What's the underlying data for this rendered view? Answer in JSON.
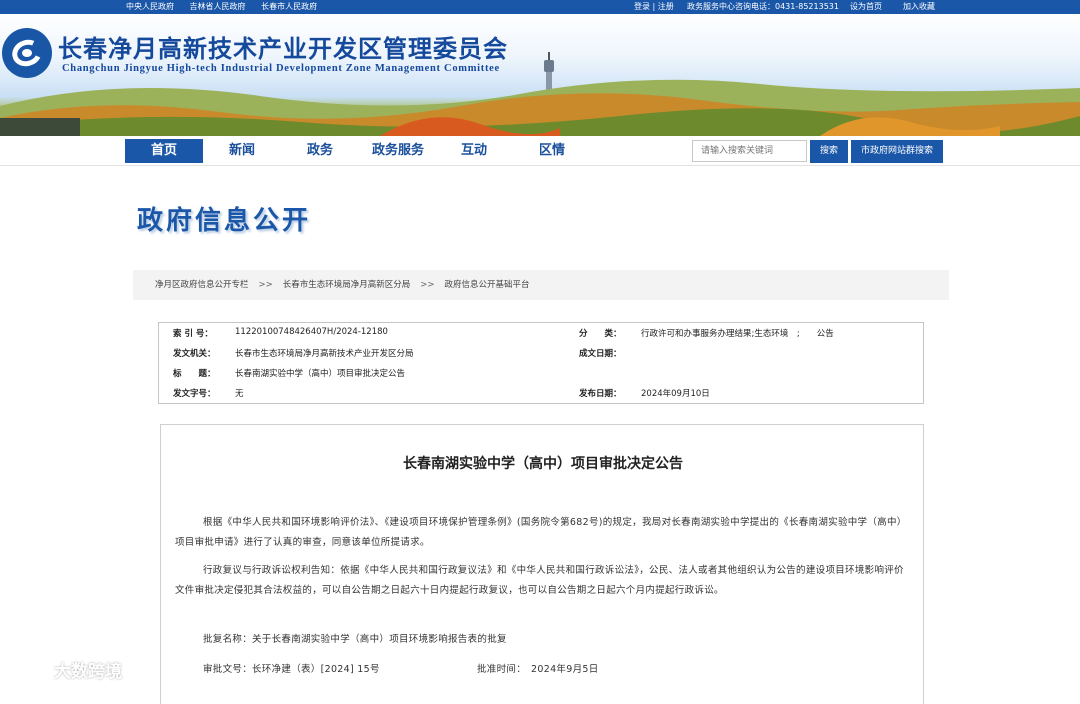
{
  "topbar": {
    "links": [
      "中央人民政府",
      "吉林省人民政府",
      "长春市人民政府"
    ],
    "login": "登录 | 注册",
    "hotline": "政务服务中心咨询电话：0431-85213531",
    "set_home": "设为首页",
    "favorite": "加入收藏"
  },
  "header": {
    "title": "长春净月高新技术产业开发区管理委员会",
    "subtitle": "Changchun Jingyue High-tech Industrial Development Zone Management Committee"
  },
  "nav": {
    "items": [
      "首页",
      "新闻",
      "政务",
      "政务服务",
      "互动",
      "区情"
    ],
    "active": "首页"
  },
  "search": {
    "placeholder": "请输入搜索关键词",
    "button": "搜索",
    "site_group_button": "市政府网站群搜索"
  },
  "section": {
    "title": "政府信息公开"
  },
  "breadcrumb": {
    "items": [
      "净月区政府信息公开专栏",
      "长春市生态环境局净月高新区分局",
      "政府信息公开基础平台"
    ],
    "separator": ">>"
  },
  "meta": {
    "index_label": "索 引 号：",
    "index_value": "11220100748426407H/2024-12180",
    "category_label": "分　　类：",
    "category_value": "行政许可和办事服务办理结果;生态环境　;　　公告",
    "issuer_label": "发文机关：",
    "issuer_value": "长春市生态环境局净月高新技术产业开发区分局",
    "written_date_label": "成文日期：",
    "written_date_value": "",
    "title_label": "标　　题：",
    "title_value": "长春南湖实验中学（高中）项目审批决定公告",
    "doc_no_label": "发文字号：",
    "doc_no_value": "无",
    "publish_date_label": "发布日期：",
    "publish_date_value": "2024年09月10日"
  },
  "article": {
    "title": "长春南湖实验中学（高中）项目审批决定公告",
    "paragraph1": "根据《中华人民共和国环境影响评价法》、《建设项目环境保护管理条例》(国务院令第682号)的规定，我局对长春南湖实验中学提出的《长春南湖实验中学（高中）项目审批申请》进行了认真的审查，同意该单位所提请求。",
    "paragraph2": "行政复议与行政诉讼权利告知：依据《中华人民共和国行政复议法》和《中华人民共和国行政诉讼法》，公民、法人或者其他组织认为公告的建设项目环境影响评价文件审批决定侵犯其合法权益的，可以自公告期之日起六十日内提起行政复议，也可以自公告期之日起六个月内提起行政诉讼。",
    "approval_name": "批复名称：关于长春南湖实验中学（高中）项目环境影响报告表的批复",
    "approval_no": "审批文号：长环净建（表）[2024] 15号",
    "approval_time": "批准时间：　2024年9月5日"
  },
  "watermark": {
    "text": "大数跨境"
  },
  "colors": {
    "brand_blue": "#1a57a8",
    "title_blue": "#15499c"
  }
}
